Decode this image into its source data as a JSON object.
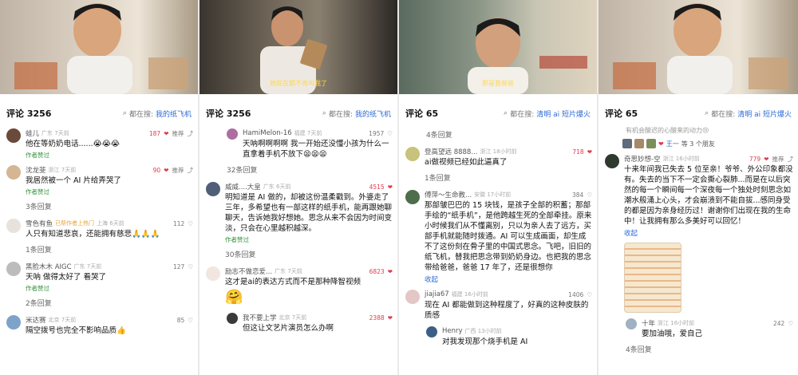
{
  "panels": [
    {
      "subtitle": "",
      "header": {
        "count": "评论 3256",
        "prefix": "都在搜:",
        "term": "我的纸飞机"
      },
      "comments": [
        {
          "name": "蛙儿",
          "loc": "广东 7天前",
          "likes": "187",
          "reply": "推荐",
          "text": "他在等奶奶电话......😭😭😭",
          "author": "作者赞过"
        },
        {
          "name": "沈龙斐",
          "loc": "浙江 7天前",
          "likes": "90",
          "reply": "推荐",
          "text": "我居然被一个 AI 片给弄哭了",
          "author": "作者赞过",
          "more": "3条回复"
        },
        {
          "name": "雪色有鱼",
          "tag": "已帮作者上热门",
          "loc": "上海 6天前",
          "likes": "112",
          "text": "人只有知道悲哀，还能拥有慈悲🙏🙏🙏",
          "more": "1条回复"
        },
        {
          "name": "黑脸木木 AIGC",
          "loc": "广东 7天前",
          "likes": "127",
          "text": "天呐 做得太好了 看哭了",
          "author": "作者赞过",
          "more": "2条回复"
        },
        {
          "name": "米达赛",
          "loc": "北京 7天前",
          "likes": "85",
          "text": "隔空拨号也完全不影响品质👍"
        }
      ]
    },
    {
      "subtitle": "她现在都不肯叫我了",
      "header": {
        "count": "评论 3256",
        "prefix": "都在搜:",
        "term": "我的纸飞机"
      },
      "comments": [
        {
          "name": "HamiMelon-16",
          "loc": "福建 7天前",
          "likes": "1957",
          "text": "天呐啊啊啊啊 我一开始还没懂小孩为什么一直拿着手机不放下😫😫😫",
          "sub": true,
          "more": "32条回复"
        },
        {
          "name": "威威....大皇",
          "loc": "广东 6天前",
          "likes": "4515",
          "text": "明知道是 AI 做的，却被这份温柔戳到。外婆走了三年，多希望也有一部这样的纸手机，能再跟她聊聊天，告诉她我好想她。思念从来不会因为时间变淡，只会在心里越积越深。",
          "author": "作者赞过",
          "more": "30条回复"
        },
        {
          "name": "励志不做恋爱...",
          "loc": "广东 7天前",
          "likes": "6823",
          "text": "这才是ai的表达方式而不是那种降智视频",
          "emoji": "🤗"
        },
        {
          "name": "我不要上学",
          "loc": "北京 7天前",
          "likes": "2388",
          "text": "但这让文艺片演员怎么办啊",
          "sub": true
        }
      ]
    },
    {
      "subtitle": "那是我爸爸",
      "header": {
        "count": "评论 65",
        "prefix": "都在搜:",
        "term": "清明 ai 短片爆火"
      },
      "topmore": "4条回复",
      "comments": [
        {
          "name": "登高望远 8888...",
          "loc": "浙江 18小时前",
          "likes": "718",
          "text": "ai做视频已经如此逼真了",
          "more": "1条回复"
        },
        {
          "name": "傅萍～生命教...",
          "loc": "安徽 17小时前",
          "likes": "384",
          "text": "那部皱巴巴的 15 块钱，是孩子全部的积蓄；那部手绘的“纸手机”，是他跨越生死的全部牵挂。原来小时候我们从不懂离别，只以为亲人去了远方，买部手机就能随时拨通。AI 可以生成画面，却生成不了这份刻在骨子里的中国式思念。飞吧，旧旧的纸飞机，替我把思念带到奶奶身边。也把我的思念带给爸爸，爸爸 17 年了，还是很想你",
          "expand": "收起"
        },
        {
          "name": "jiajia67",
          "loc": "福建 16小时前",
          "likes": "1406",
          "text": "现在 AI 都能做到这种程度了，好真的这种皮肤的质感"
        },
        {
          "name": "Henry",
          "loc": "广西 13小时前",
          "likes": "",
          "text": "对我发现那个烧手机是 AI",
          "sub": true
        }
      ]
    },
    {
      "subtitle": "",
      "header": {
        "count": "评论 65",
        "prefix": "都在搜:",
        "term": "清明 ai 短片爆火"
      },
      "cut": "有机会酸迟的心酸来的动力😢",
      "friends": {
        "name": "王一",
        "text": "等 3 个朋友"
      },
      "comments": [
        {
          "name": "奇思妙想-空",
          "loc": "浙江 16小时前",
          "likes": "779",
          "reply": "推荐",
          "text": "十来年间我已失去 5 位至亲！爷爷、外公印象都没有。失去的当下不一定会撕心裂肺...而是在以后突然的每一个瞬间每一个深夜每一个独处时刻思念如潮水般涌上心头，才会崩溃到不能自拔...感同身受的都是因为亲身经历过！谢谢你们出现在我的生命中！让我拥有那么多美好可以回忆！",
          "expand": "收起",
          "image": true
        },
        {
          "name": "十年",
          "loc": "浙江 16小时前",
          "likes": "242",
          "text": "要加油哦，爱自己",
          "sub": true
        }
      ],
      "bottommore": "4条回复"
    }
  ],
  "colors": {
    "link": "#2b6ad6",
    "like": "#e23b4a",
    "author": "#2f8f3a"
  }
}
